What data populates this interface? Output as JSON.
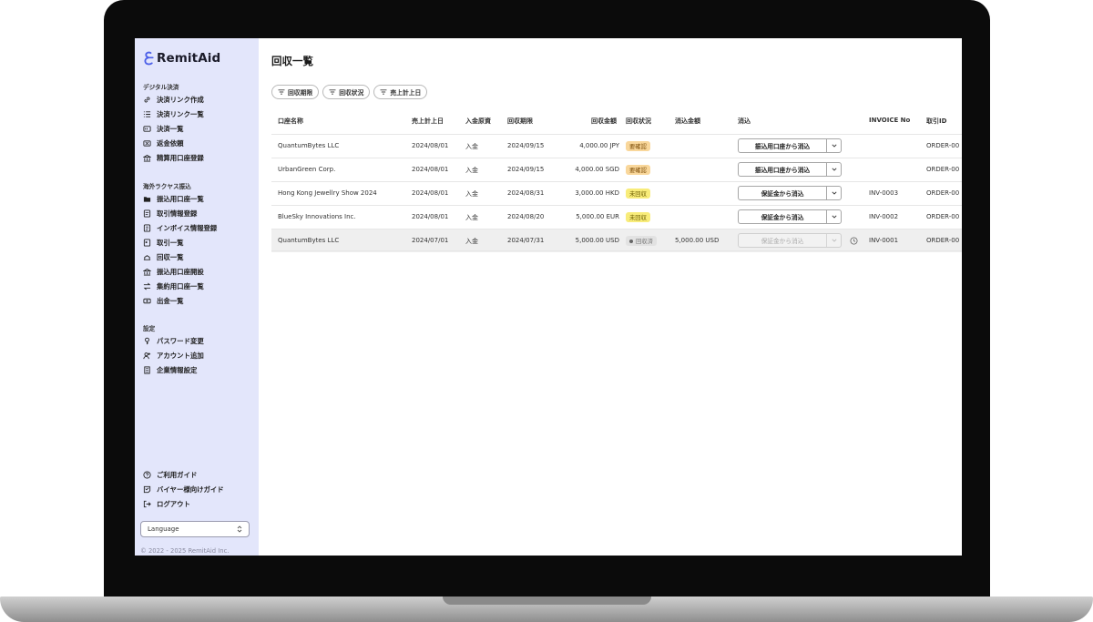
{
  "brand": {
    "name": "RemitAid"
  },
  "sidebar": {
    "sections": [
      {
        "title": "デジタル決済",
        "items": [
          {
            "label": "決済リンク作成",
            "icon": "link-icon"
          },
          {
            "label": "決済リンク一覧",
            "icon": "list-icon"
          },
          {
            "label": "決済一覧",
            "icon": "card-icon"
          },
          {
            "label": "返金依頼",
            "icon": "refund-icon"
          },
          {
            "label": "精算用口座登録",
            "icon": "bank-icon"
          }
        ]
      },
      {
        "title": "海外ラクヤス振込",
        "items": [
          {
            "label": "振込用口座一覧",
            "icon": "folder-icon"
          },
          {
            "label": "取引情報登録",
            "icon": "form-icon"
          },
          {
            "label": "インボイス情報登録",
            "icon": "invoice-icon"
          },
          {
            "label": "取引一覧",
            "icon": "document-icon"
          },
          {
            "label": "回収一覧",
            "icon": "collect-icon"
          },
          {
            "label": "振込用口座開設",
            "icon": "bank-icon"
          },
          {
            "label": "集約用口座一覧",
            "icon": "exchange-icon"
          },
          {
            "label": "出金一覧",
            "icon": "cash-icon"
          }
        ]
      },
      {
        "title": "設定",
        "items": [
          {
            "label": "パスワード変更",
            "icon": "key-icon"
          },
          {
            "label": "アカウント追加",
            "icon": "user-add-icon"
          },
          {
            "label": "企業情報設定",
            "icon": "building-icon"
          }
        ]
      }
    ],
    "footer_items": [
      {
        "label": "ご利用ガイド",
        "icon": "help-icon"
      },
      {
        "label": "バイヤー様向けガイド",
        "icon": "guide-icon"
      },
      {
        "label": "ログアウト",
        "icon": "logout-icon"
      }
    ],
    "language_label": "Language",
    "copyright": "© 2022 - 2025 RemitAid Inc."
  },
  "main": {
    "title": "回収一覧",
    "filters": [
      "回収期限",
      "回収状況",
      "売上計上日"
    ],
    "columns": [
      "口座名称",
      "売上計上日",
      "入金原資",
      "回収期限",
      "回収金額",
      "回収状況",
      "消込金額",
      "消込",
      "INVOICE No",
      "取引ID"
    ],
    "rows": [
      {
        "name": "QuantumBytes LLC",
        "sales_date": "2024/08/01",
        "source": "入金",
        "due": "2024/09/15",
        "amount": "4,000.00 JPY",
        "status": "要確認",
        "status_color": "#f9d79b",
        "cleared": "",
        "action": "振込用口座から消込",
        "invoice": "",
        "txn": "ORDER-00"
      },
      {
        "name": "UrbanGreen Corp.",
        "sales_date": "2024/08/01",
        "source": "入金",
        "due": "2024/09/15",
        "amount": "4,000.00 SGD",
        "status": "要確認",
        "status_color": "#f9d79b",
        "cleared": "",
        "action": "振込用口座から消込",
        "invoice": "",
        "txn": "ORDER-00"
      },
      {
        "name": "Hong Kong Jewellry Show 2024",
        "sales_date": "2024/08/01",
        "source": "入金",
        "due": "2024/08/31",
        "amount": "3,000.00 HKD",
        "status": "未回収",
        "status_color": "#f8ec7a",
        "cleared": "",
        "action": "保証金から消込",
        "invoice": "INV-0003",
        "txn": "ORDER-00"
      },
      {
        "name": "BlueSky Innovations Inc.",
        "sales_date": "2024/08/01",
        "source": "入金",
        "due": "2024/08/20",
        "amount": "5,000.00 EUR",
        "status": "未回収",
        "status_color": "#f8ec7a",
        "cleared": "",
        "action": "保証金から消込",
        "invoice": "INV-0002",
        "txn": "ORDER-00"
      },
      {
        "name": "QuantumBytes LLC",
        "sales_date": "2024/07/01",
        "source": "入金",
        "due": "2024/07/31",
        "amount": "5,000.00 USD",
        "status": "回収済",
        "status_color": "#e2e2e2",
        "cleared": "5,000.00 USD",
        "action": "保証金から消込",
        "invoice": "INV-0001",
        "txn": "ORDER-00"
      }
    ]
  }
}
